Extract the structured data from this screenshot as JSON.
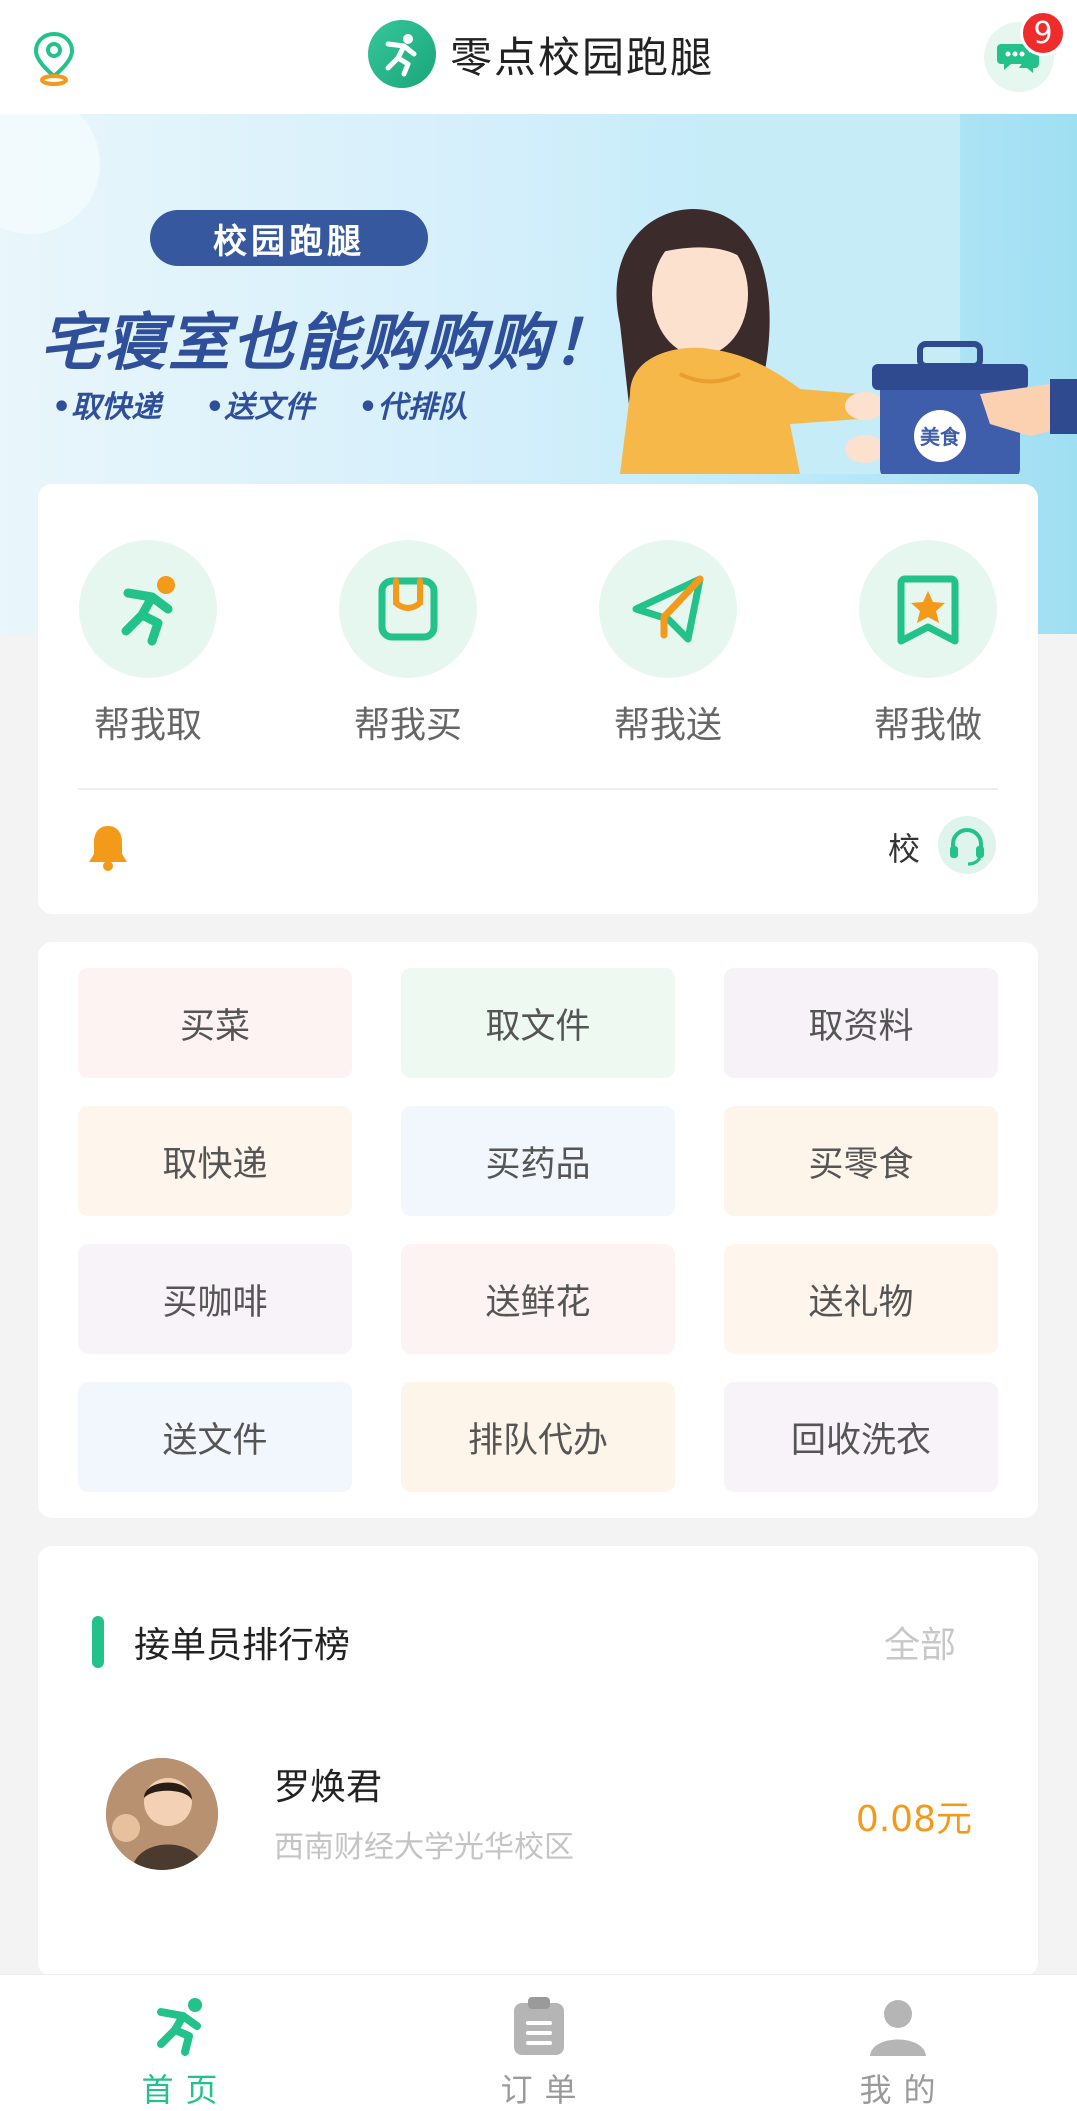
{
  "header": {
    "title": "零点校园跑腿",
    "message_badge": "9"
  },
  "banner": {
    "pill": "校园跑腿",
    "headline": "宅寝室也能购购购！",
    "tags": [
      "•取快递",
      "•送文件",
      "•代排队"
    ],
    "box_label": "美食"
  },
  "services": [
    {
      "label": "帮我取",
      "icon": "runner-icon"
    },
    {
      "label": "帮我买",
      "icon": "shopping-bag-icon"
    },
    {
      "label": "帮我送",
      "icon": "paper-plane-icon"
    },
    {
      "label": "帮我做",
      "icon": "bookmark-star-icon"
    }
  ],
  "notice": {
    "text": "校"
  },
  "categories": [
    {
      "label": "买菜",
      "bg": "#fdf3f3"
    },
    {
      "label": "取文件",
      "bg": "#eef9f2"
    },
    {
      "label": "取资料",
      "bg": "#f6f2f7"
    },
    {
      "label": "取快递",
      "bg": "#fef6ec"
    },
    {
      "label": "买药品",
      "bg": "#f2f6fd"
    },
    {
      "label": "买零食",
      "bg": "#fef5ea"
    },
    {
      "label": "买咖啡",
      "bg": "#f7f3f8"
    },
    {
      "label": "送鲜花",
      "bg": "#fdf3f3"
    },
    {
      "label": "送礼物",
      "bg": "#fef6ec"
    },
    {
      "label": "送文件",
      "bg": "#f2f6fd"
    },
    {
      "label": "排队代办",
      "bg": "#fef5ea"
    },
    {
      "label": "回收洗衣",
      "bg": "#f7f3f8"
    }
  ],
  "ranking": {
    "title": "接单员排行榜",
    "all_link": "全部",
    "entries": [
      {
        "name": "罗焕君",
        "school": "西南财经大学光华校区",
        "amount": "0.08元"
      }
    ]
  },
  "tabbar": [
    {
      "label": "首页",
      "icon": "runner-icon",
      "active": true
    },
    {
      "label": "订单",
      "icon": "clipboard-icon",
      "active": false
    },
    {
      "label": "我的",
      "icon": "user-icon",
      "active": false
    }
  ],
  "colors": {
    "accent": "#23c28b",
    "badge": "#ef2b2b",
    "amount": "#f39a1b",
    "banner_text": "#2f4f9a"
  }
}
